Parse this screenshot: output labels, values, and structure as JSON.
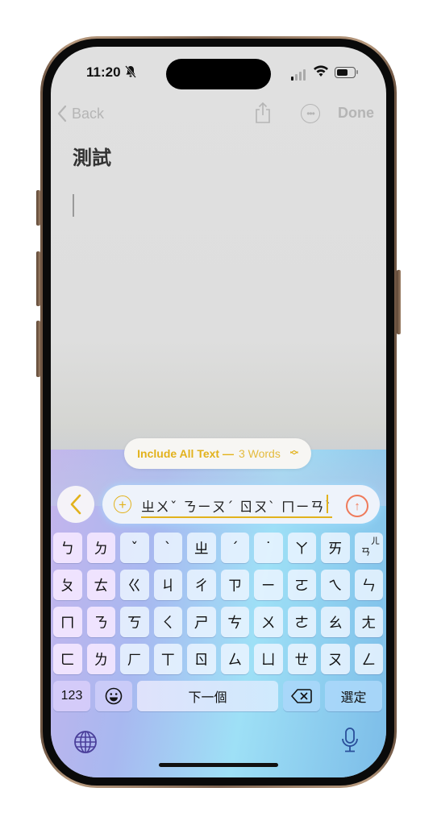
{
  "status_bar": {
    "time": "11:20",
    "silent_icon": "bell-slash-icon",
    "signal_icon": "cellular-signal-icon",
    "wifi_icon": "wifi-icon",
    "battery_icon": "battery-icon"
  },
  "navbar": {
    "back_label": "Back",
    "share_icon": "share-icon",
    "more_icon": "ellipsis-circle-icon",
    "done_label": "Done"
  },
  "note": {
    "title": "測試"
  },
  "writing_tools": {
    "scope_bold": "Include All Text —",
    "scope_count": "3 Words",
    "scope_icon": "chevron-up-down-icon",
    "back_icon": "chevron-left-icon",
    "add_icon": "plus-circle-icon",
    "input_value": "ㄓㄨˇ ㄋㄧㄡˊ ㄖㄡˋ ㄇㄧㄢˋ",
    "send_icon": "arrow-up-circle-icon",
    "accent_color": "#e2b21c"
  },
  "keyboard": {
    "rows": [
      [
        "ㄅ",
        "ㄉ",
        "ˇ",
        "ˋ",
        "ㄓ",
        "ˊ",
        "˙",
        "ㄚ",
        "ㄞ",
        "ㄢ"
      ],
      [
        "ㄆ",
        "ㄊ",
        "ㄍ",
        "ㄐ",
        "ㄔ",
        "ㄗ",
        "ㄧ",
        "ㄛ",
        "ㄟ",
        "ㄣ"
      ],
      [
        "ㄇ",
        "ㄋ",
        "ㄎ",
        "ㄑ",
        "ㄕ",
        "ㄘ",
        "ㄨ",
        "ㄜ",
        "ㄠ",
        "ㄤ"
      ],
      [
        "ㄈ",
        "ㄌ",
        "ㄏ",
        "ㄒ",
        "ㄖ",
        "ㄙ",
        "ㄩ",
        "ㄝ",
        "ㄡ",
        "ㄥ"
      ]
    ],
    "last_key_alt": "ㄦ",
    "numbers_label": "123",
    "emoji_icon": "emoji-icon",
    "space_label": "下一個",
    "delete_icon": "delete-icon",
    "select_label": "選定",
    "globe_icon": "globe-icon",
    "mic_icon": "microphone-icon"
  }
}
